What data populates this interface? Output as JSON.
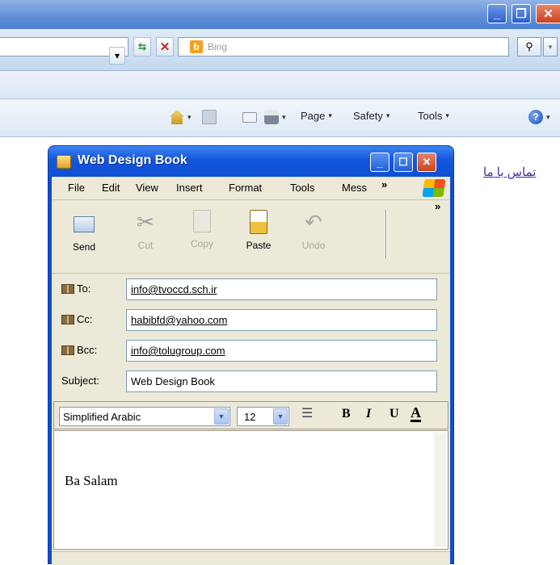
{
  "ie": {
    "search_placeholder": "Bing",
    "search_brand_letter": "b",
    "command_bar": {
      "page_label": "Page",
      "safety_label": "Safety",
      "tools_label": "Tools"
    }
  },
  "page": {
    "contact_link": "تماس با ما"
  },
  "compose": {
    "title": "Web Design Book",
    "menu": [
      "File",
      "Edit",
      "View",
      "Insert",
      "Format",
      "Tools",
      "Mess"
    ],
    "menu_overflow": "»",
    "toolbar_overflow": "»",
    "toolbar": {
      "send": "Send",
      "cut": "Cut",
      "copy": "Copy",
      "paste": "Paste",
      "undo": "Undo"
    },
    "to_label": "To:",
    "to_value": "info@tvoccd.sch.ir",
    "cc_label": "Cc:",
    "cc_value": "habibfd@yahoo.com",
    "bcc_label": "Bcc:",
    "bcc_value": "info@tolugroup.com",
    "subject_label": "Subject:",
    "subject_value": "Web Design Book",
    "font_name": "Simplified Arabic",
    "font_size": "12",
    "bold": "B",
    "italic": "I",
    "underline": "U",
    "font_color": "A",
    "body_text": "Ba Salam"
  },
  "colors": {
    "ie_title_blue": "#5f8ed8",
    "xp_title_blue": "#1456dc",
    "xp_face": "#ece9d8",
    "link_purple": "#4a2a9e"
  }
}
